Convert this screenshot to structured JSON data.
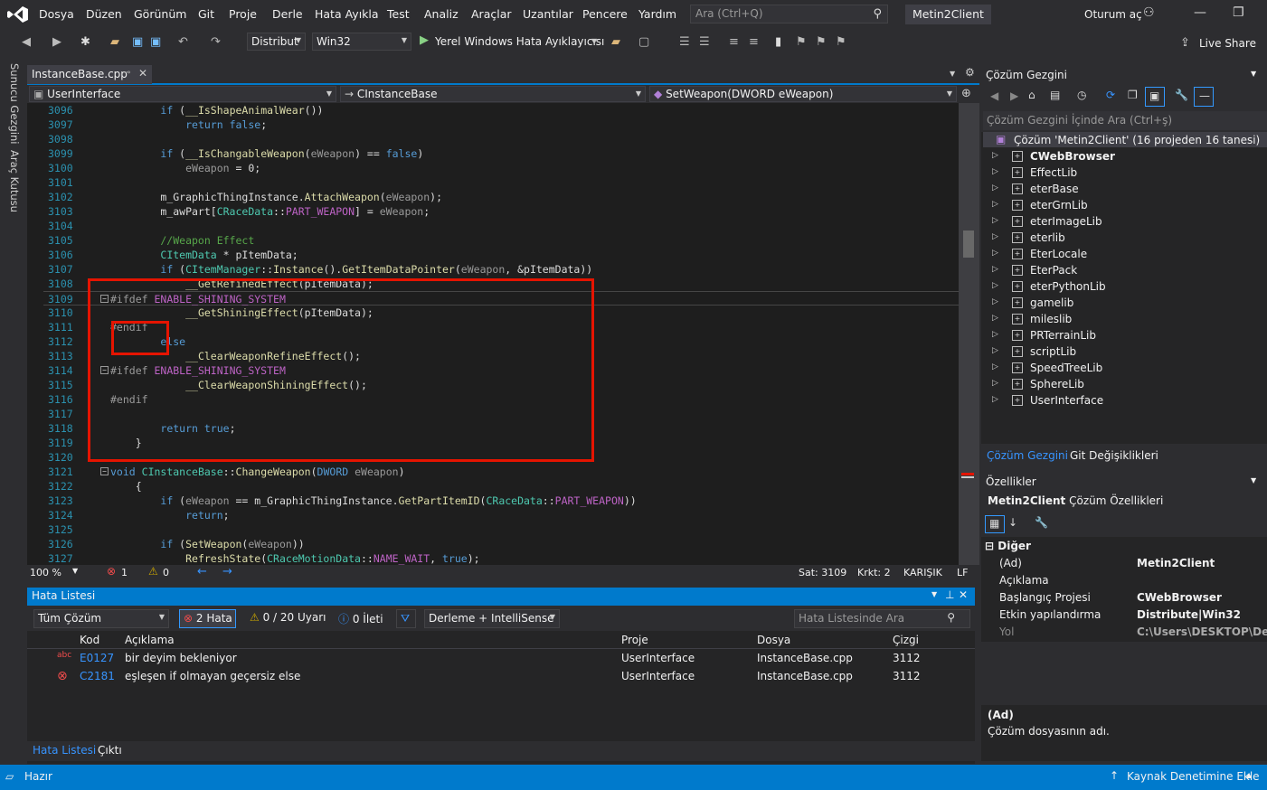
{
  "menu": {
    "items": [
      "Dosya",
      "Düzen",
      "Görünüm",
      "Git",
      "Proje",
      "Derle",
      "Hata Ayıkla",
      "Test",
      "Analiz",
      "Araçlar",
      "Uzantılar",
      "Pencere",
      "Yardım"
    ],
    "search_placeholder": "Ara (Ctrl+Q)",
    "solution_name": "Metin2Client",
    "sign_in": "Oturum aç",
    "live_share": "Live Share"
  },
  "toolbar": {
    "config": "Distribut",
    "platform": "Win32",
    "debugger": "Yerel Windows Hata Ayıklayıcısı"
  },
  "left_strip": [
    "Sunucu Gezgini",
    "Araç Kutusu"
  ],
  "editor": {
    "tab_name": "InstanceBase.cpp",
    "nav_project": "UserInterface",
    "nav_class": "CInstanceBase",
    "nav_member": "SetWeapon(DWORD eWeapon)",
    "zoom": "100 %",
    "error_count": "1",
    "warning_count": "0",
    "line": "Sat: 3109",
    "char": "Krkt: 2",
    "encoding": "KARIŞIK",
    "eol": "LF",
    "lines": [
      {
        "n": "3096",
        "t": "        if (__IsShapeAnimalWear())"
      },
      {
        "n": "3097",
        "t": "            return false;"
      },
      {
        "n": "3098",
        "t": ""
      },
      {
        "n": "3099",
        "t": "        if (__IsChangableWeapon(eWeapon) == false)"
      },
      {
        "n": "3100",
        "t": "            eWeapon = 0;"
      },
      {
        "n": "3101",
        "t": ""
      },
      {
        "n": "3102",
        "t": "        m_GraphicThingInstance.AttachWeapon(eWeapon);"
      },
      {
        "n": "3103",
        "t": "        m_awPart[CRaceData::PART_WEAPON] = eWeapon;"
      },
      {
        "n": "3104",
        "t": ""
      },
      {
        "n": "3105",
        "t": "        //Weapon Effect"
      },
      {
        "n": "3106",
        "t": "        CItemData * pItemData;"
      },
      {
        "n": "3107",
        "t": "        if (CItemManager::Instance().GetItemDataPointer(eWeapon, &pItemData))"
      },
      {
        "n": "3108",
        "t": "            __GetRefinedEffect(pItemData);"
      },
      {
        "n": "3109",
        "t": "#ifdef ENABLE_SHINING_SYSTEM"
      },
      {
        "n": "3110",
        "t": "            __GetShiningEffect(pItemData);"
      },
      {
        "n": "3111",
        "t": "#endif"
      },
      {
        "n": "3112",
        "t": "        else"
      },
      {
        "n": "3113",
        "t": "            __ClearWeaponRefineEffect();"
      },
      {
        "n": "3114",
        "t": "#ifdef ENABLE_SHINING_SYSTEM"
      },
      {
        "n": "3115",
        "t": "            __ClearWeaponShiningEffect();"
      },
      {
        "n": "3116",
        "t": "#endif"
      },
      {
        "n": "3117",
        "t": ""
      },
      {
        "n": "3118",
        "t": "        return true;"
      },
      {
        "n": "3119",
        "t": "    }"
      },
      {
        "n": "3120",
        "t": ""
      },
      {
        "n": "3121",
        "t": "void CInstanceBase::ChangeWeapon(DWORD eWeapon)"
      },
      {
        "n": "3122",
        "t": "    {"
      },
      {
        "n": "3123",
        "t": "        if (eWeapon == m_GraphicThingInstance.GetPartItemID(CRaceData::PART_WEAPON))"
      },
      {
        "n": "3124",
        "t": "            return;"
      },
      {
        "n": "3125",
        "t": ""
      },
      {
        "n": "3126",
        "t": "        if (SetWeapon(eWeapon))"
      },
      {
        "n": "3127",
        "t": "            RefreshState(CRaceMotionData::NAME_WAIT, true);"
      }
    ]
  },
  "error_list": {
    "title": "Hata Listesi",
    "scope": "Tüm Çözüm",
    "errors_btn": "2 Hata",
    "warnings_btn": "0 / 20 Uyarı",
    "messages_btn": "0 İleti",
    "build_filter": "Derleme + IntelliSense",
    "search_placeholder": "Hata Listesinde Ara",
    "columns": [
      "Kod",
      "Açıklama",
      "Proje",
      "Dosya",
      "Çizgi"
    ],
    "rows": [
      {
        "code": "E0127",
        "desc": "bir deyim bekleniyor",
        "project": "UserInterface",
        "file": "InstanceBase.cpp",
        "line": "3112"
      },
      {
        "code": "C2181",
        "desc": "eşleşen if olmayan geçersiz else",
        "project": "UserInterface",
        "file": "InstanceBase.cpp",
        "line": "3112"
      }
    ],
    "tabs": [
      "Hata Listesi",
      "Çıktı"
    ]
  },
  "solution_explorer": {
    "title": "Çözüm Gezgini",
    "search_placeholder": "Çözüm Gezgini İçinde Ara (Ctrl+ş)",
    "root": "Çözüm 'Metin2Client' (16 projeden 16 tanesi)",
    "projects": [
      "CWebBrowser",
      "EffectLib",
      "eterBase",
      "eterGrnLib",
      "eterImageLib",
      "eterlib",
      "EterLocale",
      "EterPack",
      "eterPythonLib",
      "gamelib",
      "mileslib",
      "PRTerrainLib",
      "scriptLib",
      "SpeedTreeLib",
      "SphereLib",
      "UserInterface"
    ],
    "tabs": [
      "Çözüm Gezgini",
      "Git Değişiklikleri"
    ]
  },
  "properties": {
    "title": "Özellikler",
    "object": "Metin2Client",
    "object_type": "Çözüm Özellikleri",
    "category": "Diğer",
    "rows": [
      {
        "k": "(Ad)",
        "v": "Metin2Client"
      },
      {
        "k": "Açıklama",
        "v": ""
      },
      {
        "k": "Başlangıç Projesi",
        "v": "CWebBrowser"
      },
      {
        "k": "Etkin yapılandırma",
        "v": "Distribute|Win32"
      },
      {
        "k": "Yol",
        "v": "C:\\Users\\DESKTOP\\Deskt"
      }
    ],
    "desc_title": "(Ad)",
    "desc_text": "Çözüm dosyasının adı."
  },
  "statusbar": {
    "ready": "Hazır",
    "source_control": "Kaynak Denetimine Ekle"
  },
  "colors": {
    "accent": "#007acc",
    "error_box": "#e51400"
  }
}
